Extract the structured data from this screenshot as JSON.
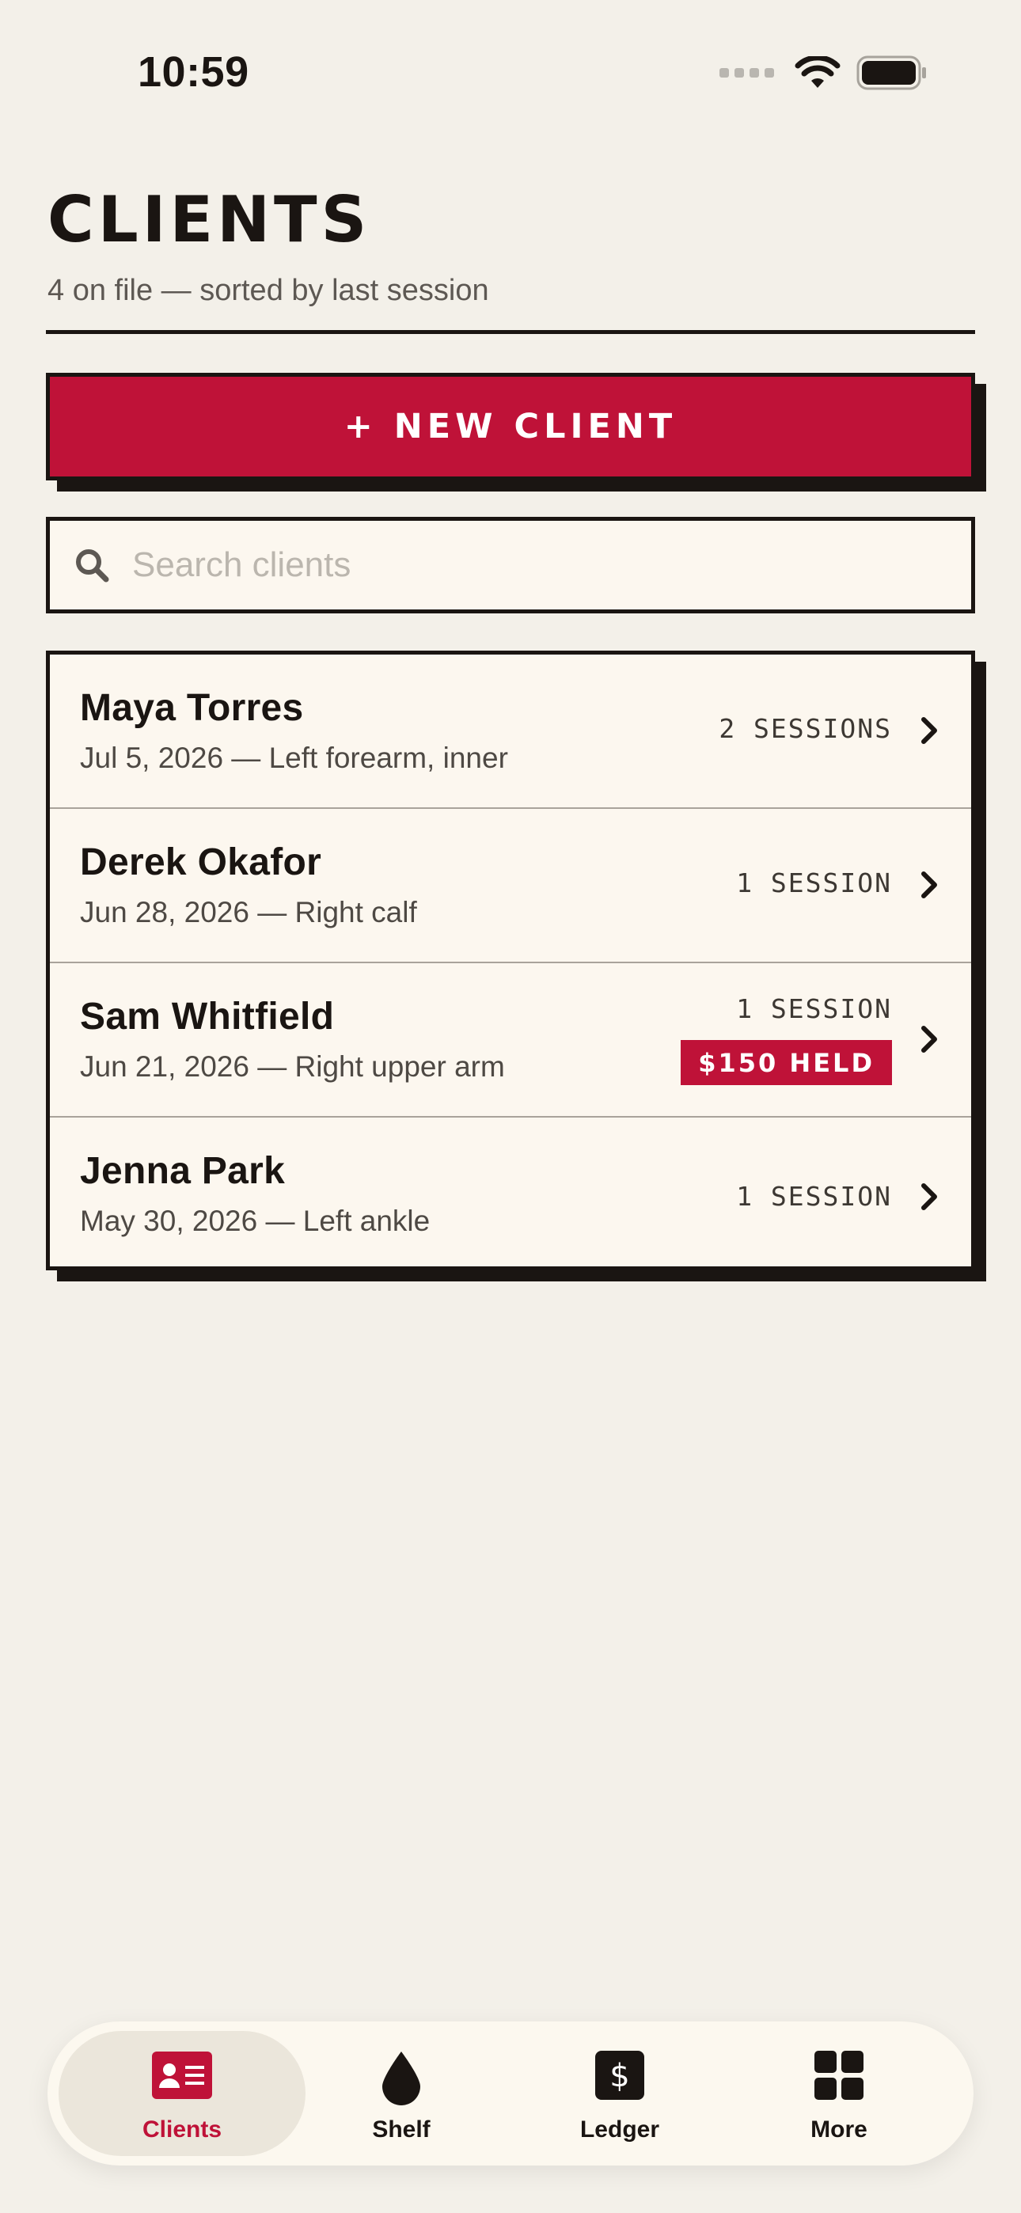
{
  "status_bar": {
    "time": "10:59"
  },
  "header": {
    "title": "CLIENTS",
    "subtitle": "4 on file — sorted by last session"
  },
  "new_client_button": {
    "label": "+ NEW CLIENT"
  },
  "search": {
    "placeholder": "Search clients",
    "value": ""
  },
  "clients": [
    {
      "name": "Maya Torres",
      "detail": "Jul 5, 2026 — Left forearm, inner",
      "sessions": "2 SESSIONS",
      "badge": ""
    },
    {
      "name": "Derek Okafor",
      "detail": "Jun 28, 2026 — Right calf",
      "sessions": "1 SESSION",
      "badge": ""
    },
    {
      "name": "Sam Whitfield",
      "detail": "Jun 21, 2026 — Right upper arm",
      "sessions": "1 SESSION",
      "badge": "$150 HELD"
    },
    {
      "name": "Jenna Park",
      "detail": "May 30, 2026 — Left ankle",
      "sessions": "1 SESSION",
      "badge": ""
    }
  ],
  "tab_bar": {
    "tabs": [
      {
        "label": "Clients",
        "icon": "id-card-icon",
        "active": true
      },
      {
        "label": "Shelf",
        "icon": "ink-drop-icon",
        "active": false
      },
      {
        "label": "Ledger",
        "icon": "dollar-icon",
        "active": false
      },
      {
        "label": "More",
        "icon": "grid-icon",
        "active": false
      }
    ]
  },
  "colors": {
    "accent": "#bf1238",
    "ink": "#1a1512",
    "background": "#f3f0e9",
    "card": "#fcf7ef"
  }
}
